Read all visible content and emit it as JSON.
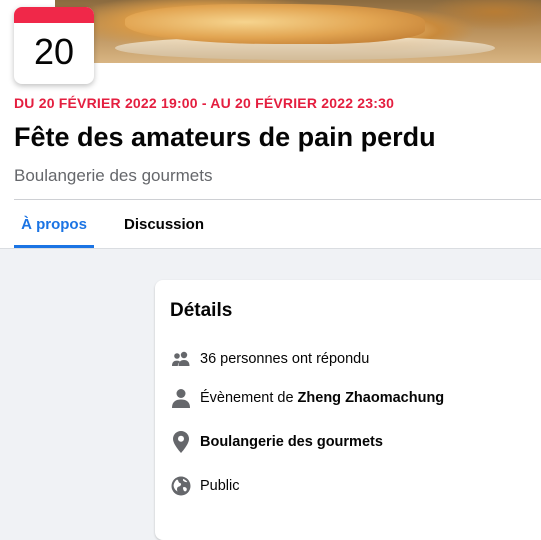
{
  "event": {
    "calendar_day": "20",
    "date_range": "DU 20 FÉVRIER 2022 19:00 - AU 20 FÉVRIER 2022 23:30",
    "title": "Fête des amateurs de pain perdu",
    "location_subtitle": "Boulangerie des gourmets"
  },
  "tabs": [
    {
      "label": "À propos",
      "active": true
    },
    {
      "label": "Discussion",
      "active": false
    }
  ],
  "details": {
    "heading": "Détails",
    "responses": {
      "icon": "people-icon",
      "text": "36 personnes ont répondu"
    },
    "host": {
      "icon": "person-icon",
      "prefix": "Évènement de",
      "name": "Zheng Zhaomachung"
    },
    "place": {
      "icon": "location-pin-icon",
      "text": "Boulangerie des gourmets"
    },
    "privacy": {
      "icon": "globe-icon",
      "text": "Public"
    }
  },
  "colors": {
    "accent": "#1b74e4",
    "date_red": "#e41e3f",
    "calendar_red": "#f02849",
    "icon_gray": "#65676b"
  }
}
